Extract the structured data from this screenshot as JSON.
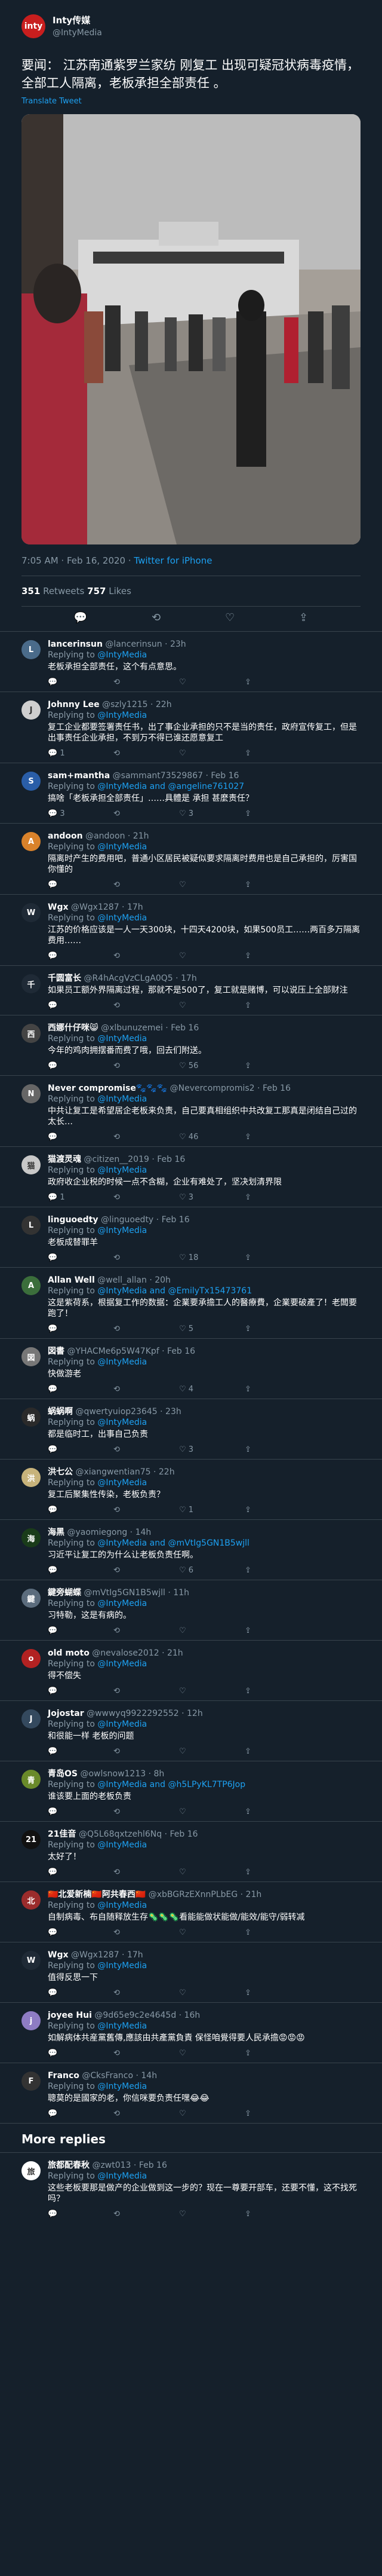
{
  "tweet": {
    "author_name": "Inty传媒",
    "author_handle": "@IntyMedia",
    "avatar_text": "inty",
    "text": "要闻：  江苏南通紫罗兰家纺  刚复工  出现可疑冠状病毒疫情，全部工人隔离，老板承担全部责任 。",
    "translate_label": "Translate Tweet",
    "time": "7:05 AM · Feb 16, 2020 · ",
    "source": "Twitter for iPhone",
    "retweets": "351",
    "retweets_label": " Retweets   ",
    "likes": "757",
    "likes_label": " Likes"
  },
  "replying_label": "Replying to ",
  "replies": [
    {
      "name": "lancerinsun",
      "handle": "@lancerinsun · 23h",
      "to": "@IntyMedia",
      "text": "老板承担全部责任，这个有点意思。",
      "counts": [
        "",
        "",
        ""
      ],
      "color": "#4a6b8a",
      "initial": "L"
    },
    {
      "name": "Johnny Lee",
      "handle": "@szly1215 · 22h",
      "to": "@IntyMedia",
      "text": "复工企业都要签署责任书，出了事企业承担的只不是当的责任，政府宣传复工，但是出事责任企业承担，不到万不得已谁还愿意复工",
      "counts": [
        "1",
        "",
        ""
      ],
      "color": "#cfcfcf",
      "initial": "J"
    },
    {
      "name": "sam+mantha",
      "handle": "@sammant73529867 · Feb 16",
      "to": "@IntyMedia and @angeline761027",
      "text": "搞啥「老板承担全部责任」……具體是 承担 甚麼责任？",
      "counts": [
        "3",
        "",
        "3"
      ],
      "color": "#2a5ea8",
      "initial": "S"
    },
    {
      "name": "andoon",
      "handle": "@andoon · 21h",
      "to": "@IntyMedia",
      "text": "隔离时产生的费用吧，普通小区居民被疑似要求隔离时费用也是自己承担的，厉害国你懂的",
      "counts": [
        "",
        "",
        ""
      ],
      "color": "#d9822b",
      "initial": "A"
    },
    {
      "name": "Wgx",
      "handle": "@Wgx1287 · 17h",
      "to": "@IntyMedia",
      "text": "江苏的价格应该是一人一天300块，十四天4200块，如果500员工……两百多万隔离费用……",
      "counts": [
        "",
        "",
        ""
      ],
      "color": "#1f2a36",
      "initial": "W"
    },
    {
      "name": "千圆富长",
      "handle": "@R4hAcgVzCLgA0Q5 · 17h",
      "to": "",
      "text": "如果员工额外界隔离过程，那就不是500了，复工就是赌博，可以说压上全部财注",
      "counts": [
        "",
        "",
        ""
      ],
      "color": "#1f2a36",
      "initial": "千"
    },
    {
      "name": "西娜什仔咪😸",
      "handle": "@xlbunuzemei · Feb 16",
      "to": "@IntyMedia",
      "text": "今年的鸡肉拥摆番而费了哦，回去们附送。",
      "counts": [
        "",
        "",
        "56"
      ],
      "color": "#444",
      "initial": "西"
    },
    {
      "name": "Never compromise🐾🐾🐾",
      "handle": "@Nevercompromis2 · Feb 16",
      "to": "@IntyMedia",
      "text": "中共让复工是希望居企老板来负责，自己要真相组织中共改复工那真是闭结自己过的太长…",
      "counts": [
        "",
        "",
        "46"
      ],
      "color": "#666",
      "initial": "N"
    },
    {
      "name": "猫渡灵魂",
      "handle": "@citizen__2019 · Feb 16",
      "to": "@IntyMedia",
      "text": "政府收企业税的时候一点不含糊，企业有难处了，坚决划清界限",
      "counts": [
        "1",
        "",
        "3"
      ],
      "color": "#c8c8c8",
      "initial": "猫"
    },
    {
      "name": "linguoedty",
      "handle": "@linguoedty · Feb 16",
      "to": "@IntyMedia",
      "text": "老板成替罪羊",
      "counts": [
        "",
        "",
        "18"
      ],
      "color": "#333",
      "initial": "L"
    },
    {
      "name": "Allan Well",
      "handle": "@well_allan · 20h",
      "to": "@IntyMedia and @EmilyTx15473761",
      "text": "这是紫荷系，根据复工作的数据：企業要承擔工人的醫療費，企業要破產了！老闆要跑了！",
      "counts": [
        "",
        "",
        "5"
      ],
      "color": "#3b6e3b",
      "initial": "A"
    },
    {
      "name": "図書",
      "handle": "@YHACMe6p5W47Kpf · Feb 16",
      "to": "@IntyMedia",
      "text": "快做游老",
      "counts": [
        "",
        "",
        "4"
      ],
      "color": "#777",
      "initial": "図"
    },
    {
      "name": "蜗蜗啊",
      "handle": "@qwertyuiop23645 · 23h",
      "to": "@IntyMedia",
      "text": "都是临时工，出事自己负责",
      "counts": [
        "",
        "",
        "3"
      ],
      "color": "#2a2a2a",
      "initial": "蜗"
    },
    {
      "name": "洪七公",
      "handle": "@xiangwentian75 · 22h",
      "to": "@IntyMedia",
      "text": "复工后聚集性传染，老板负责？",
      "counts": [
        "",
        "",
        "1"
      ],
      "color": "#c7b37b",
      "initial": "洪"
    },
    {
      "name": "海黑",
      "handle": "@yaomiegong · 14h",
      "to": "@IntyMedia and @mVtIg5GN1B5wjll",
      "text": "习近平让复工的为什么让老板负责任啊。",
      "counts": [
        "",
        "",
        "6"
      ],
      "color": "#1a3c1a",
      "initial": "海"
    },
    {
      "name": "鍵旁蝴蝶",
      "handle": "@mVtIg5GN1B5wjll · 11h",
      "to": "@IntyMedia",
      "text": "习特勒，这是有病的。",
      "counts": [
        "",
        "",
        ""
      ],
      "color": "#5b6c7d",
      "initial": "鍵"
    },
    {
      "name": "old moto",
      "handle": "@nevalose2012 · 21h",
      "to": "@IntyMedia",
      "text": "得不偿失",
      "counts": [
        "",
        "",
        ""
      ],
      "color": "#b22222",
      "initial": "o"
    },
    {
      "name": "Jojostar",
      "handle": "@wwwyq9922292552 · 12h",
      "to": "@IntyMedia",
      "text": "和很能一样  老板的问题",
      "counts": [
        "",
        "",
        ""
      ],
      "color": "#34495e",
      "initial": "J"
    },
    {
      "name": "青岛OS",
      "handle": "@owlsnow1213 · 8h",
      "to": "@IntyMedia and @h5LPyKL7TP6Jop",
      "text": "谁该要上面的老板负责",
      "counts": [
        "",
        "",
        ""
      ],
      "color": "#6a8a2a",
      "initial": "青"
    },
    {
      "name": "21佳音",
      "handle": "@Q5L68qxtzehl6Nq · Feb 16",
      "to": "@IntyMedia",
      "text": "太好了！",
      "counts": [
        "",
        "",
        ""
      ],
      "color": "#111",
      "initial": "21"
    },
    {
      "name": "🇨🇳北爱新楠🇨🇳阿共春西🇨🇳",
      "handle": "@xbBGRzEXnnPLbEG · 21h",
      "to": "@IntyMedia",
      "text": "自制病毒、布自随释放生存🦠🦠🦠看能能做状能做/能效/能守/弱转减",
      "counts": [
        "",
        "",
        ""
      ],
      "color": "#9b2c2c",
      "initial": "北"
    },
    {
      "name": "Wgx",
      "handle": "@Wgx1287 · 17h",
      "to": "@IntyMedia",
      "text": "值得反思一下",
      "counts": [
        "",
        "",
        ""
      ],
      "color": "#1f2a36",
      "initial": "W"
    },
    {
      "name": "joyee Hui",
      "handle": "@9d65e9c2e4645d · 16h",
      "to": "@IntyMedia",
      "text": "如解病体共産黨舊傳,應該由共產黨負責 保怪咱覺得要人民承擔😡😡😡",
      "counts": [
        "",
        "",
        ""
      ],
      "color": "#8e7cc3",
      "initial": "j"
    },
    {
      "name": "Franco",
      "handle": "@CksFranco · 14h",
      "to": "@IntyMedia",
      "text": "聰莫的是國家的老，你信咪要负责任嘿😂😂",
      "counts": [
        "",
        "",
        ""
      ],
      "color": "#333",
      "initial": "F"
    }
  ],
  "more_replies_label": "More replies",
  "more_replies": [
    {
      "name": "旅都配春秋",
      "handle": "@zwt013 · Feb 16",
      "to": "@IntyMedia",
      "text": "这些老板要那是做产的企业做到这一步的？现在一尊要开部车，还要不懂，这不找死吗？",
      "counts": [
        "",
        "",
        ""
      ],
      "color": "#ffffff",
      "initial": "旅"
    }
  ],
  "icons": {
    "reply": "reply-icon",
    "retweet": "retweet-icon",
    "like": "heart-icon",
    "share": "share-icon"
  }
}
